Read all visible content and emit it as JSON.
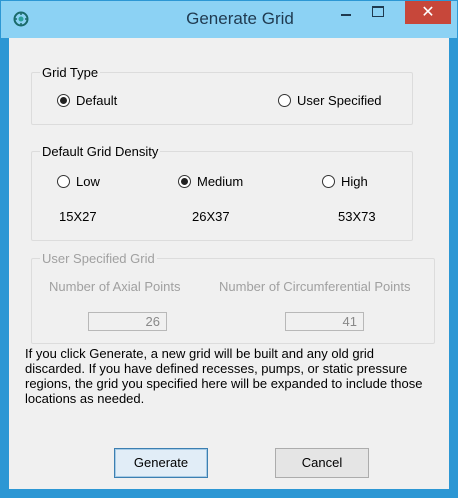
{
  "window": {
    "title": "Generate Grid",
    "close_label": "✕"
  },
  "grid_type": {
    "legend": "Grid Type",
    "options": [
      {
        "label": "Default",
        "selected": true
      },
      {
        "label": "User Specified",
        "selected": false
      }
    ]
  },
  "density": {
    "legend": "Default Grid Density",
    "options": [
      {
        "label": "Low",
        "size": "15X27",
        "selected": false
      },
      {
        "label": "Medium",
        "size": "26X37",
        "selected": true
      },
      {
        "label": "High",
        "size": "53X73",
        "selected": false
      }
    ]
  },
  "user_grid": {
    "legend": "User Specified Grid",
    "axial_label": "Number of Axial Points",
    "axial_value": "26",
    "circ_label": "Number of Circumferential Points",
    "circ_value": "41"
  },
  "info_text": "If you click Generate, a new grid will be built and any old grid discarded. If you have defined recesses, pumps, or static pressure regions, the grid you specified here will be expanded to include those locations as needed.",
  "buttons": {
    "generate": "Generate",
    "cancel": "Cancel"
  },
  "colors": {
    "titlebar": "#8cd2f4",
    "close": "#c7473a",
    "frame": "#2c97d4"
  }
}
